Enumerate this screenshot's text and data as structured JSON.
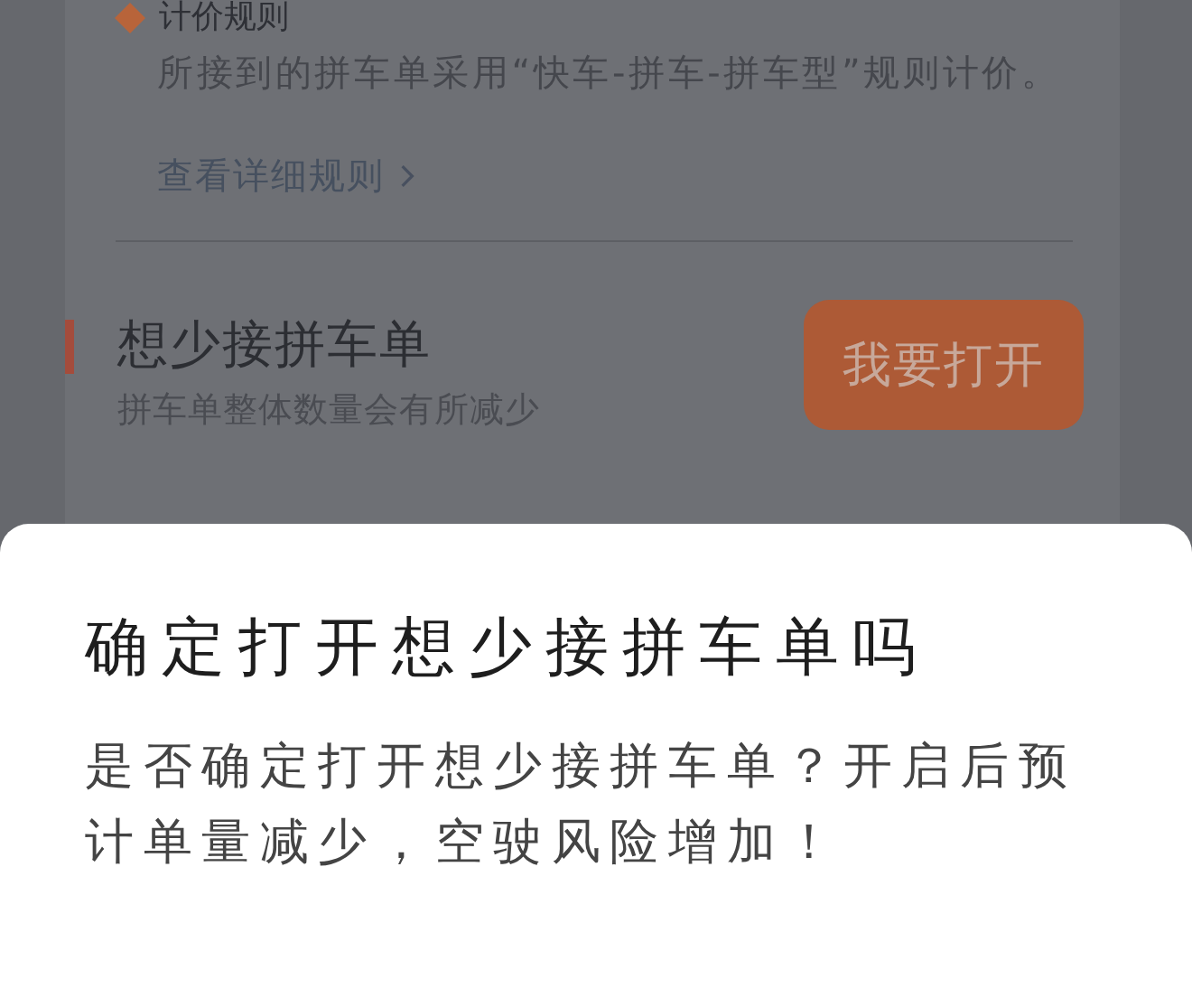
{
  "background_page": {
    "pricing_rule": {
      "title": "计价规则",
      "description": "所接到的拼车单采用“快车-拼车-拼车型”规则计价。",
      "link": "查看详细规则"
    },
    "setting": {
      "title": "想少接拼车单",
      "subtitle": "拼车单整体数量会有所减少",
      "button": "我要打开"
    }
  },
  "dialog": {
    "title": "确定打开想少接拼车单吗",
    "message": "是否确定打开想少接拼车单？开启后预计单量减少，空驶风险增加！"
  }
}
